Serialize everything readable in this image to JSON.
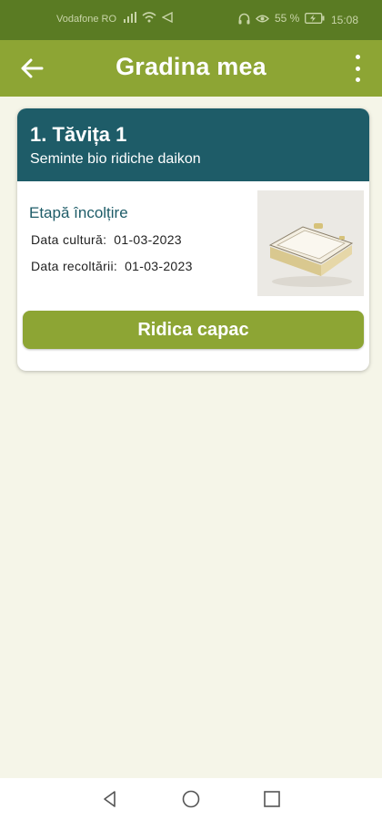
{
  "status_bar": {
    "carrier": "Vodafone RO",
    "battery": "55 %",
    "time": "15:08"
  },
  "app_bar": {
    "title": "Gradina mea",
    "back_icon": "arrow-left-icon",
    "menu_icon": "more-vertical-icon"
  },
  "tray_card": {
    "title": "1. Tăvița 1",
    "subtitle": "Seminte bio ridiche daikon",
    "stage": "Etapă încolțire",
    "culture_label": "Data cultură:",
    "culture_date": "01-03-2023",
    "harvest_label": "Data recoltării:",
    "harvest_date": "01-03-2023",
    "image_icon": "tray-image",
    "button_label": "Ridica capac"
  },
  "colors": {
    "status_bar": "#5a7b23",
    "app_bar": "#8da534",
    "card_header": "#1e5c68",
    "background": "#f5f5e8",
    "button": "#8da534"
  },
  "nav_bar": {
    "back_icon": "triangle-back-icon",
    "home_icon": "circle-home-icon",
    "recent_icon": "square-recent-icon"
  }
}
